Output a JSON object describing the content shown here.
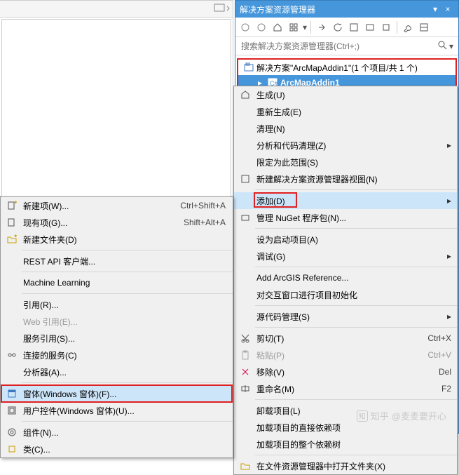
{
  "solutionExplorer": {
    "title": "解决方案资源管理器",
    "searchPlaceholder": "搜索解决方案资源管理器(Ctrl+;)",
    "solutionNode": "解决方案\"ArcMapAddin1\"(1 个项目/共 1 个)",
    "projectNode": "ArcMapAddin1"
  },
  "contextMenu": {
    "items": [
      {
        "label": "生成(U)"
      },
      {
        "label": "重新生成(E)"
      },
      {
        "label": "清理(N)"
      },
      {
        "label": "分析和代码清理(Z)",
        "arrow": true
      },
      {
        "label": "限定为此范围(S)"
      },
      {
        "label": "新建解决方案资源管理器视图(N)"
      },
      {
        "sep": true
      },
      {
        "label": "添加(D)",
        "arrow": true,
        "highlighted": true,
        "redbox": true
      },
      {
        "label": "管理 NuGet 程序包(N)..."
      },
      {
        "sep": true
      },
      {
        "label": "设为启动项目(A)"
      },
      {
        "label": "调试(G)",
        "arrow": true
      },
      {
        "sep": true
      },
      {
        "label": "Add ArcGIS Reference..."
      },
      {
        "label": "对交互窗口进行项目初始化"
      },
      {
        "sep": true
      },
      {
        "label": "源代码管理(S)",
        "arrow": true
      },
      {
        "sep": true
      },
      {
        "label": "剪切(T)",
        "shortcut": "Ctrl+X",
        "icon": "cut"
      },
      {
        "label": "粘贴(P)",
        "shortcut": "Ctrl+V",
        "icon": "paste",
        "disabled": true
      },
      {
        "label": "移除(V)",
        "shortcut": "Del",
        "icon": "remove"
      },
      {
        "label": "重命名(M)",
        "shortcut": "F2",
        "icon": "rename"
      },
      {
        "sep": true
      },
      {
        "label": "卸载项目(L)"
      },
      {
        "label": "加载项目的直接依赖项"
      },
      {
        "label": "加载项目的整个依赖树"
      },
      {
        "sep": true
      },
      {
        "label": "在文件资源管理器中打开文件夹(X)",
        "icon": "folder"
      }
    ]
  },
  "addSubmenu": {
    "items": [
      {
        "label": "新建项(W)...",
        "shortcut": "Ctrl+Shift+A",
        "icon": "newitem"
      },
      {
        "label": "现有项(G)...",
        "shortcut": "Shift+Alt+A",
        "icon": "existitem"
      },
      {
        "label": "新建文件夹(D)",
        "icon": "newfolder"
      },
      {
        "sep": true
      },
      {
        "label": "REST API 客户端..."
      },
      {
        "sep": true
      },
      {
        "label": "Machine Learning"
      },
      {
        "sep": true
      },
      {
        "label": "引用(R)..."
      },
      {
        "label": "Web 引用(E)...",
        "disabled": true
      },
      {
        "label": "服务引用(S)..."
      },
      {
        "label": "连接的服务(C)",
        "icon": "connected"
      },
      {
        "label": "分析器(A)..."
      },
      {
        "sep": true
      },
      {
        "label": "窗体(Windows 窗体)(F)...",
        "icon": "form",
        "highlighted": true,
        "redbox": true
      },
      {
        "label": "用户控件(Windows 窗体)(U)...",
        "icon": "usercontrol"
      },
      {
        "sep": true
      },
      {
        "label": "组件(N)...",
        "icon": "component"
      },
      {
        "label": "类(C)...",
        "icon": "class"
      }
    ]
  },
  "watermark": {
    "brand": "知乎",
    "author": "@麦麦要开心"
  }
}
